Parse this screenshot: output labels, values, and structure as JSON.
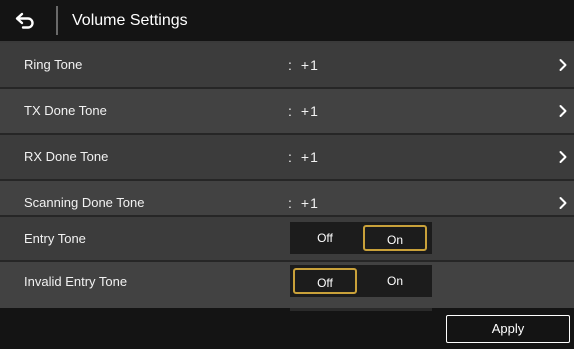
{
  "header": {
    "title": "Volume Settings",
    "back_icon": "back-arrow-icon"
  },
  "rows": [
    {
      "label": "Ring Tone",
      "colon": ":",
      "value": "+1"
    },
    {
      "label": "TX Done Tone",
      "colon": ":",
      "value": "+1"
    },
    {
      "label": "RX Done Tone",
      "colon": ":",
      "value": "+1"
    },
    {
      "label": "Scanning Done Tone",
      "colon": ":",
      "value": "+1"
    }
  ],
  "toggles": [
    {
      "label": "Entry Tone",
      "off_label": "Off",
      "on_label": "On",
      "selected": "On"
    },
    {
      "label": "Invalid Entry Tone",
      "off_label": "Off",
      "on_label": "On",
      "selected": "Off"
    }
  ],
  "footer": {
    "apply_label": "Apply"
  },
  "colors": {
    "accent": "#c9a13a",
    "header_bg": "#141414",
    "row_bg": "#3c3c3c"
  }
}
